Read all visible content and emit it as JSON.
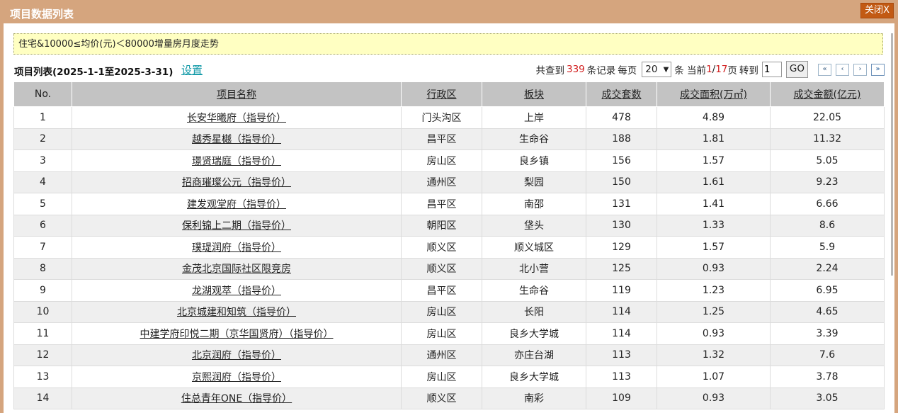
{
  "window": {
    "title": "项目数据列表",
    "close_label": "关闭X"
  },
  "notice": "住宅&10000≤均价(元)＜80000增量房月度走势",
  "list": {
    "title": "项目列表(2025-1-1至2025-3-31)",
    "settings_link": "设置"
  },
  "pager": {
    "found_prefix": "共查到",
    "total_records": "339",
    "records_suffix": "条记录",
    "per_page_label": "每页",
    "per_page_value": "20",
    "current_label": "条 当前",
    "current_page": "1",
    "page_sep": "/",
    "total_pages": "17",
    "page_suffix": "页",
    "goto_label": "转到",
    "goto_value": "1",
    "go_label": "GO",
    "first_icon": "«",
    "prev_icon": "‹",
    "next_icon": "›",
    "last_icon": "»"
  },
  "table": {
    "headers": [
      "No.",
      "项目名称",
      "行政区",
      "板块",
      "成交套数",
      "成交面积(万㎡)",
      "成交金额(亿元)"
    ],
    "rows": [
      [
        "1",
        "长安华曦府（指导价）",
        "门头沟区",
        "上岸",
        "478",
        "4.89",
        "22.05"
      ],
      [
        "2",
        "越秀星樾（指导价）",
        "昌平区",
        "生命谷",
        "188",
        "1.81",
        "11.32"
      ],
      [
        "3",
        "璟贤瑞庭（指导价）",
        "房山区",
        "良乡镇",
        "156",
        "1.57",
        "5.05"
      ],
      [
        "4",
        "招商璀璨公元（指导价）",
        "通州区",
        "梨园",
        "150",
        "1.61",
        "9.23"
      ],
      [
        "5",
        "建发观堂府（指导价）",
        "昌平区",
        "南邵",
        "131",
        "1.41",
        "6.66"
      ],
      [
        "6",
        "保利锦上二期（指导价）",
        "朝阳区",
        "垡头",
        "130",
        "1.33",
        "8.6"
      ],
      [
        "7",
        "璞瑅润府（指导价）",
        "顺义区",
        "顺义城区",
        "129",
        "1.57",
        "5.9"
      ],
      [
        "8",
        "金茂北京国际社区限竞房",
        "顺义区",
        "北小营",
        "125",
        "0.93",
        "2.24"
      ],
      [
        "9",
        "龙湖观萃（指导价）",
        "昌平区",
        "生命谷",
        "119",
        "1.23",
        "6.95"
      ],
      [
        "10",
        "北京城建和知筑（指导价）",
        "房山区",
        "长阳",
        "114",
        "1.25",
        "4.65"
      ],
      [
        "11",
        "中建学府印悦二期（京华国贤府）（指导价）",
        "房山区",
        "良乡大学城",
        "114",
        "0.93",
        "3.39"
      ],
      [
        "12",
        "北京润府（指导价）",
        "通州区",
        "亦庄台湖",
        "113",
        "1.32",
        "7.6"
      ],
      [
        "13",
        "京熙润府（指导价）",
        "房山区",
        "良乡大学城",
        "113",
        "1.07",
        "3.78"
      ],
      [
        "14",
        "住总青年ONE（指导价）",
        "顺义区",
        "南彩",
        "109",
        "0.93",
        "3.05"
      ]
    ]
  }
}
